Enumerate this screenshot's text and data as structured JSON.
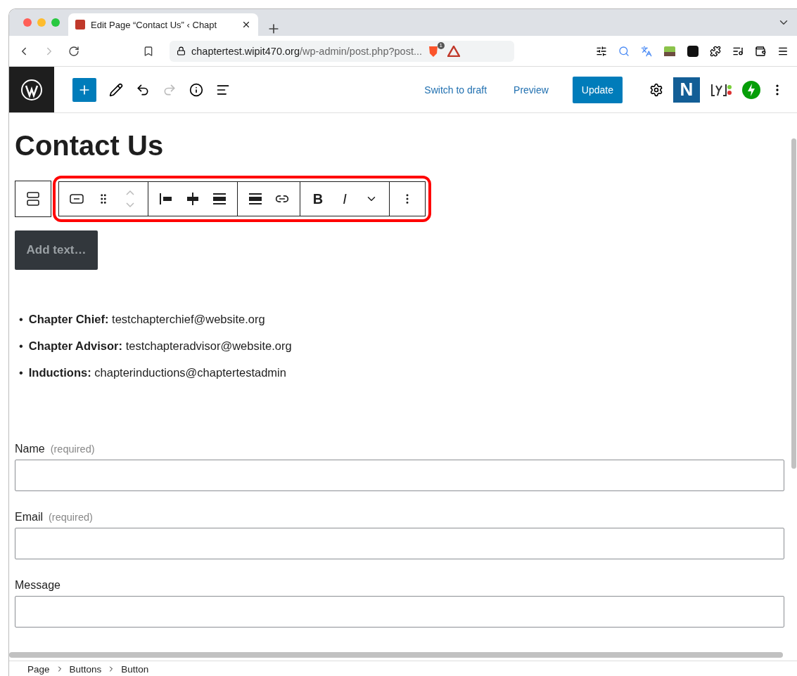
{
  "browser": {
    "tab_title": "Edit Page “Contact Us” ‹ Chapt",
    "url_host": "chaptertest.wipit470.org",
    "url_path": "/wp-admin/post.php?post...",
    "shield_count": "1"
  },
  "editor_toolbar": {
    "switch_to_draft": "Switch to draft",
    "preview": "Preview",
    "update": "Update",
    "plugin_letter": "N"
  },
  "title": "Contact Us",
  "block_toolbar": {
    "bold": "B",
    "italic": "I"
  },
  "button_block": {
    "placeholder": "Add text…"
  },
  "contacts": [
    {
      "marker": "•",
      "label": "Chapter Chief:",
      "value": "testchapterchief@website.org"
    },
    {
      "marker": "•",
      "label": "Chapter Advisor:",
      "value": "testchapteradvisor@website.org"
    },
    {
      "marker": "•",
      "label": "Inductions:",
      "value": "chapterinductions@chaptertestadmin"
    }
  ],
  "form_fields": [
    {
      "label": "Name",
      "hint": "(required)"
    },
    {
      "label": "Email",
      "hint": "(required)"
    },
    {
      "label": "Message"
    }
  ],
  "breadcrumb": [
    "Page",
    "Buttons",
    "Button"
  ]
}
